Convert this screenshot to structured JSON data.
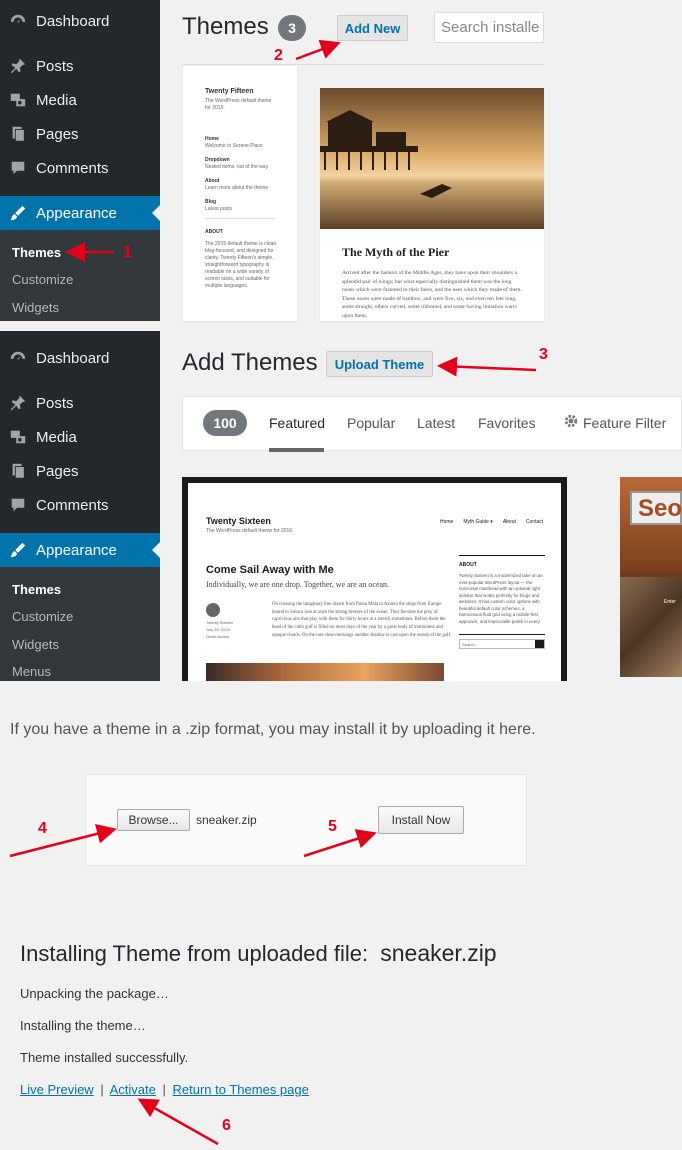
{
  "sidebar_top": {
    "items": [
      {
        "label": "Dashboard",
        "icon": "dashboard-icon"
      },
      {
        "label": "Posts",
        "icon": "pin-icon"
      },
      {
        "label": "Media",
        "icon": "media-icon"
      },
      {
        "label": "Pages",
        "icon": "pages-icon"
      },
      {
        "label": "Comments",
        "icon": "comments-icon"
      },
      {
        "label": "Appearance",
        "icon": "brush-icon"
      }
    ],
    "sub": [
      "Themes",
      "Customize",
      "Widgets"
    ]
  },
  "sidebar_bottom": {
    "items": [
      {
        "label": "Dashboard",
        "icon": "dashboard-icon"
      },
      {
        "label": "Posts",
        "icon": "pin-icon"
      },
      {
        "label": "Media",
        "icon": "media-icon"
      },
      {
        "label": "Pages",
        "icon": "pages-icon"
      },
      {
        "label": "Comments",
        "icon": "comments-icon"
      },
      {
        "label": "Appearance",
        "icon": "brush-icon"
      }
    ],
    "sub": [
      "Themes",
      "Customize",
      "Widgets",
      "Menus"
    ]
  },
  "themes_header": {
    "title": "Themes",
    "count": "3",
    "add_new": "Add New",
    "search_placeholder": "Search installe"
  },
  "theme_preview_1": {
    "site_title": "Twenty Fifteen",
    "tagline": "The WordPress default theme for 2015.",
    "nav": [
      {
        "label": "Home",
        "sub": "Welcome to Serene Place"
      },
      {
        "label": "Dropdown",
        "sub": "Nested items, out of the way"
      },
      {
        "label": "About",
        "sub": "Learn more about the theme"
      },
      {
        "label": "Blog",
        "sub": "Latest posts"
      }
    ],
    "about_heading": "ABOUT",
    "about_text": "The 2015 default theme is clean, blog-focused, and designed for clarity. Twenty Fifteen's simple, straightforward typography is readable on a wide variety of screen sizes, and suitable for multiple languages."
  },
  "theme_preview_2": {
    "post_title": "The Myth of the Pier",
    "post_text": "Arrived after the fashion of the Middle Ages, they have upon their shoulders a splendid pair of wings; but what especially distinguished them was the long noses which were fastened to their faces, and the uses which they made of them. These noses were made of bamboo, and were five, six, and even ten feet long, some straight, others curved, some ribboned, and some having imitation warts upon them."
  },
  "add_themes": {
    "title": "Add Themes",
    "upload_button": "Upload Theme",
    "count": "100",
    "tabs": [
      "Featured",
      "Popular",
      "Latest",
      "Favorites"
    ],
    "feature_filter": "Feature Filter"
  },
  "sixteen_preview": {
    "site_title": "Twenty Sixteen",
    "tagline": "The WordPress default theme for 2016",
    "nav": [
      "Home",
      "Myth Guide ▾",
      "About",
      "Contact"
    ],
    "post_title": "Come Sail Away with Me",
    "post_lead": "Individually, we are one drop. Together, we are an ocean.",
    "post_body": "On crossing the imaginary line drawn from Punta Mala to Azuera the ships from Europe bound to Sulaco lose at once the strong breezes of the ocean. They become the prey of capricious airs that play with them for thirty hours at a stretch sometimes. Before them the head of the calm gulf is filled on most days of the year by a great body of motionless and opaque clouds. On the rare clear mornings another shadow is cast upon the sweep of the gulf.",
    "author_lines": [
      "Twenty Sixteen",
      "July 25, 2015",
      "Guest Author"
    ],
    "widget_heading": "ABOUT",
    "widget_text": "Twenty Sixteen is a modernized take on an ever-popular WordPress layout — the horizontal masthead with an optional right sidebar that works perfectly for blogs and websites. It has custom color options with beautiful default color schemes, a harmonious fluid grid using a mobile-first approach, and impeccable polish in every detail. Twenty Sixteen will make your WordPress look beautiful everywhere.",
    "search_placeholder": "Search ..."
  },
  "partial_card": {
    "text": "Seo",
    "button": "Enter"
  },
  "upload": {
    "intro": "If you have a theme in a .zip format, you may install it by uploading it here.",
    "browse": "Browse...",
    "filename": "sneaker.zip",
    "install": "Install Now"
  },
  "install": {
    "heading": "Installing Theme from uploaded file:",
    "file": "sneaker.zip",
    "steps": [
      "Unpacking the package…",
      "Installing the theme…",
      "Theme installed successfully."
    ],
    "links": [
      "Live Preview",
      "Activate",
      "Return to Themes page"
    ],
    "sep": "|"
  },
  "markers": [
    "1",
    "2",
    "3",
    "4",
    "5",
    "6"
  ],
  "colors": {
    "sidebar": "#23282d",
    "active": "#0073aa",
    "arrow": "#e3001b"
  }
}
